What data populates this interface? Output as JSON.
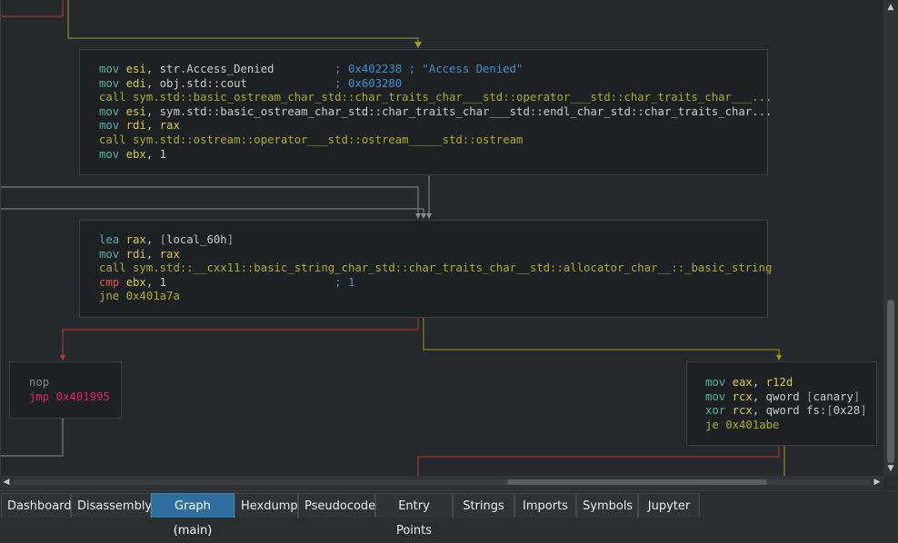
{
  "colors": {
    "background": "#25292e",
    "block_bg": "#1e2124",
    "edge_true": "#9c9e1c",
    "edge_false": "#c0392b",
    "edge_uncond": "#8a8f94",
    "active_tab": "#2f6f9f"
  },
  "graph": {
    "block1": [
      {
        "op": "mov",
        "args": "esi, str.Access_Denied",
        "comment": "; 0x402238 ; \"Access Denied\""
      },
      {
        "op": "mov",
        "args": "edi, obj.std::cout",
        "comment": "; 0x603280"
      },
      {
        "op": "call",
        "args": "sym.std::basic_ostream_char_std::char_traits_char___std::operator___std::char_traits_char___..."
      },
      {
        "op": "mov",
        "args": "esi, sym.std::basic_ostream_char_std::char_traits_char___std::endl_char_std::char_traits_char..."
      },
      {
        "op": "mov",
        "args": "rdi, rax"
      },
      {
        "op": "call",
        "args": "sym.std::ostream::operator___std::ostream_____std::ostream"
      },
      {
        "op": "mov",
        "args": "ebx, 1"
      }
    ],
    "block2": [
      {
        "op": "lea",
        "args": "rax, [local_60h]"
      },
      {
        "op": "mov",
        "args": "rdi, rax"
      },
      {
        "op": "call",
        "args": "sym.std::__cxx11::basic_string_char_std::char_traits_char__std::allocator_char__::_basic_string"
      },
      {
        "op": "cmp",
        "args": "ebx, 1",
        "comment": "; 1"
      },
      {
        "op": "jne",
        "args": "0x401a7a"
      }
    ],
    "block3": [
      {
        "op": "nop",
        "args": ""
      },
      {
        "op": "jmp",
        "args": "0x401995"
      }
    ],
    "block4": [
      {
        "op": "mov",
        "args": "eax, r12d"
      },
      {
        "op": "mov",
        "args": "rcx, qword [canary]"
      },
      {
        "op": "xor",
        "args": "rcx, qword fs:[0x28]"
      },
      {
        "op": "je",
        "args": "0x401abe"
      }
    ]
  },
  "scroll": {
    "left_arrow_icon": "◀",
    "right_arrow_icon": "▶",
    "up_arrow_icon": "▲",
    "down_arrow_icon": "▼"
  },
  "tabs": [
    {
      "label": "Dashboard",
      "active": false
    },
    {
      "label": "Disassembly",
      "active": false
    },
    {
      "label": "Graph (main)",
      "active": true
    },
    {
      "label": "Hexdump",
      "active": false
    },
    {
      "label": "Pseudocode",
      "active": false
    },
    {
      "label": "Entry Points",
      "active": false
    },
    {
      "label": "Strings",
      "active": false
    },
    {
      "label": "Imports",
      "active": false
    },
    {
      "label": "Symbols",
      "active": false
    },
    {
      "label": "Jupyter",
      "active": false
    }
  ]
}
